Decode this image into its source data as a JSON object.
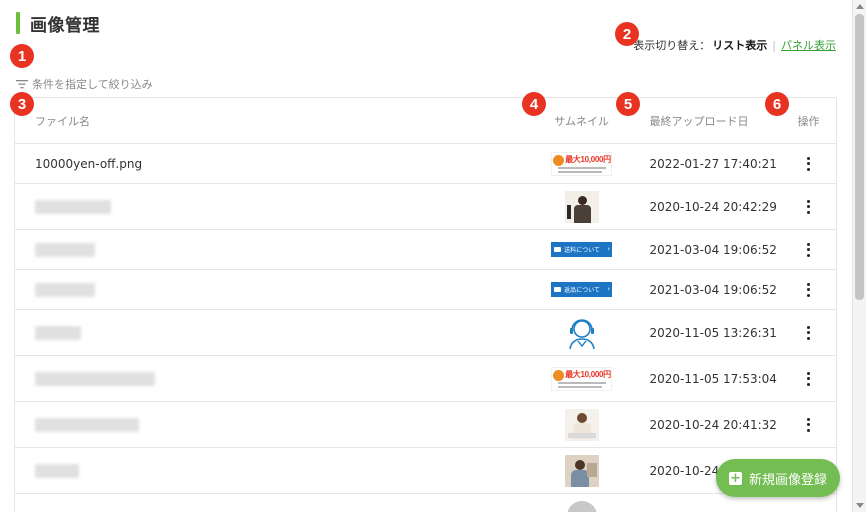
{
  "page": {
    "title": "画像管理"
  },
  "view_switch": {
    "label": "表示切り替え：",
    "active": "リスト表示",
    "separator": "|",
    "other": "パネル表示"
  },
  "filter": {
    "label": "条件を指定して絞り込み",
    "icon": "filter-icon"
  },
  "table": {
    "headers": {
      "file_name": "ファイル名",
      "thumbnail": "サムネイル",
      "last_upload": "最終アップロード日",
      "ops": "操作"
    },
    "rows": [
      {
        "file_name": "10000yen-off.png",
        "date": "2022-01-27 17:40:21",
        "thumb": "banner-10000"
      },
      {
        "file_name": "",
        "date": "2020-10-24 20:42:29",
        "thumb": "photo-man"
      },
      {
        "file_name": "",
        "date": "2021-03-04 19:06:52",
        "thumb": "blue-shipping"
      },
      {
        "file_name": "",
        "date": "2021-03-04 19:06:52",
        "thumb": "blue-return"
      },
      {
        "file_name": "",
        "date": "2020-11-05 13:26:31",
        "thumb": "support-icon"
      },
      {
        "file_name": "",
        "date": "2020-11-05 17:53:04",
        "thumb": "banner-10000"
      },
      {
        "file_name": "",
        "date": "2020-10-24 20:41:32",
        "thumb": "photo-woman"
      },
      {
        "file_name": "",
        "date": "2020-10-24 21:10:20",
        "thumb": "photo-woman-2"
      }
    ],
    "banner_amount": "10,000",
    "shipping_label": "送料について",
    "return_label": "返品について"
  },
  "badges": [
    "1",
    "2",
    "3",
    "4",
    "5",
    "6"
  ],
  "fab": {
    "label": "新規画像登録",
    "plus": "+"
  },
  "colors": {
    "accent_green": "#6cbf3a",
    "fab_green": "#73bd53",
    "link_green": "#3aa03a",
    "badge_red": "#e83323",
    "thumb_blue": "#1d74c3"
  }
}
